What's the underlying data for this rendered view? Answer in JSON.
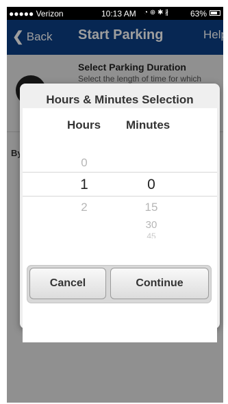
{
  "status_bar": {
    "carrier": "●●●●● Verizon",
    "time": "10:13 AM",
    "battery": "63%",
    "icons": "◔ ⊕ ✱ ∦"
  },
  "nav": {
    "back_label": "Back",
    "title": "Start Parking",
    "help_label": "Help"
  },
  "background": {
    "duration_title": "Select Parking Duration",
    "duration_subtitle": "Select the length of time for which",
    "by_label": "By"
  },
  "dialog": {
    "title": "Hours & Minutes Selection",
    "hours_header": "Hours",
    "minutes_header": "Minutes",
    "hours_above": "0",
    "hours_selected": "1",
    "hours_below": "2",
    "minutes_selected": "0",
    "minutes_below_1": "15",
    "minutes_below_2": "30",
    "minutes_below_3": "45",
    "cancel_label": "Cancel",
    "continue_label": "Continue"
  }
}
